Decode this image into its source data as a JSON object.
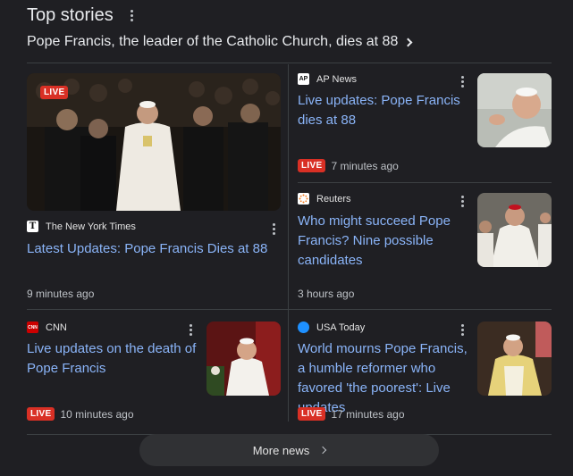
{
  "header": {
    "title": "Top stories"
  },
  "headline": {
    "text": "Pope Francis, the leader of the Catholic Church, dies at 88"
  },
  "stories": [
    {
      "source": "The New York Times",
      "title": "Latest Updates: Pope Francis Dies at 88",
      "time": "9 minutes ago",
      "image_live": "LIVE"
    },
    {
      "source": "AP News",
      "title": "Live updates: Pope Francis dies at 88",
      "time": "7 minutes ago",
      "live": "LIVE"
    },
    {
      "source": "Reuters",
      "title": "Who might succeed Pope Francis? Nine possible candidates",
      "time": "3 hours ago"
    },
    {
      "source": "CNN",
      "title": "Live updates on the death of Pope Francis",
      "time": "10 minutes ago",
      "live": "LIVE"
    },
    {
      "source": "USA Today",
      "title": "World mourns Pope Francis, a humble reformer who favored 'the poorest': Live updates",
      "time": "17 minutes ago",
      "live": "LIVE"
    }
  ],
  "icons": {
    "nyt": "T",
    "ap": "AP",
    "cnn": "CNN"
  },
  "more": {
    "label": "More news"
  },
  "colors": {
    "link": "#8ab4f8",
    "live": "#d93025",
    "background": "#1f1f23"
  }
}
